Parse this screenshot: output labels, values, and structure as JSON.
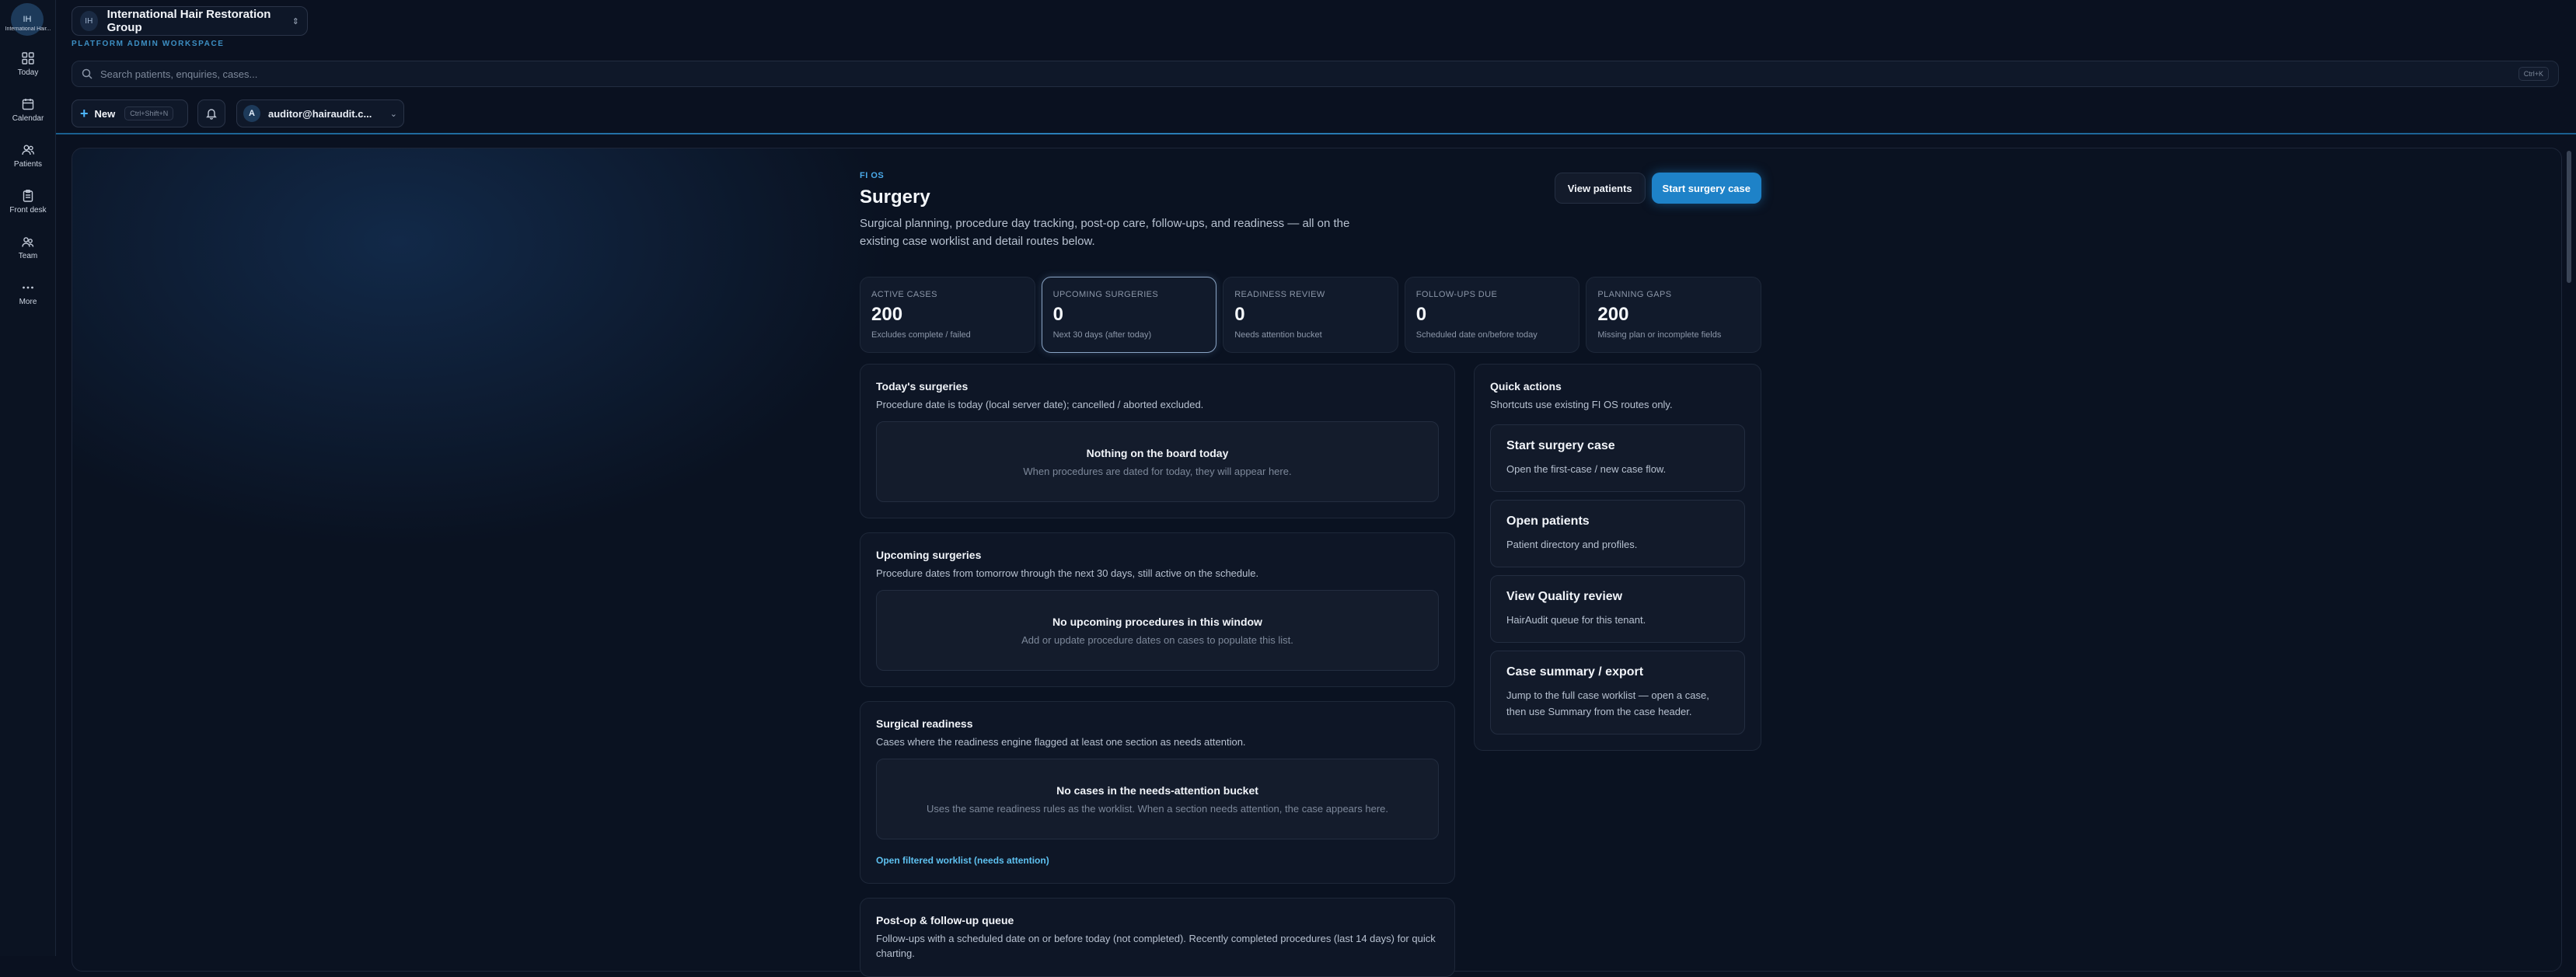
{
  "rail": {
    "logo_initials": "IH",
    "logo_caption": "International Hair...",
    "items": [
      {
        "label": "Today",
        "icon": "grid-icon"
      },
      {
        "label": "Calendar",
        "icon": "calendar-icon"
      },
      {
        "label": "Patients",
        "icon": "users-icon"
      },
      {
        "label": "Front desk",
        "icon": "clipboard-icon"
      },
      {
        "label": "Team",
        "icon": "team-icon"
      },
      {
        "label": "More",
        "icon": "more-icon"
      }
    ]
  },
  "header": {
    "tenant_initials": "IH",
    "tenant_name": "International Hair Restoration Group",
    "workspace_label": "PLATFORM ADMIN WORKSPACE",
    "search_placeholder": "Search patients, enquiries, cases...",
    "search_shortcut": "Ctrl+K",
    "new_label": "New",
    "new_shortcut": "Ctrl+Shift+N",
    "user_initial": "A",
    "user_email": "auditor@hairaudit.c..."
  },
  "page": {
    "kicker": "FI OS",
    "title": "Surgery",
    "description": "Surgical planning, procedure day tracking, post-op care, follow-ups, and readiness — all on the existing case worklist and detail routes below.",
    "view_patients_label": "View patients",
    "start_case_label": "Start surgery case"
  },
  "kpis": [
    {
      "label": "ACTIVE CASES",
      "value": "200",
      "note": "Excludes complete / failed"
    },
    {
      "label": "UPCOMING SURGERIES",
      "value": "0",
      "note": "Next 30 days (after today)"
    },
    {
      "label": "READINESS REVIEW",
      "value": "0",
      "note": "Needs attention bucket"
    },
    {
      "label": "FOLLOW-UPS DUE",
      "value": "0",
      "note": "Scheduled date on/before today"
    },
    {
      "label": "PLANNING GAPS",
      "value": "200",
      "note": "Missing plan or incomplete fields"
    }
  ],
  "sections": {
    "today": {
      "title": "Today's surgeries",
      "desc": "Procedure date is today (local server date); cancelled / aborted excluded.",
      "empty_title": "Nothing on the board today",
      "empty_desc": "When procedures are dated for today, they will appear here."
    },
    "upcoming": {
      "title": "Upcoming surgeries",
      "desc": "Procedure dates from tomorrow through the next 30 days, still active on the schedule.",
      "empty_title": "No upcoming procedures in this window",
      "empty_desc": "Add or update procedure dates on cases to populate this list."
    },
    "readiness": {
      "title": "Surgical readiness",
      "desc": "Cases where the readiness engine flagged at least one section as needs attention.",
      "empty_title": "No cases in the needs-attention bucket",
      "empty_desc": "Uses the same readiness rules as the worklist. When a section needs attention, the case appears here.",
      "link": "Open filtered worklist (needs attention)"
    },
    "postop": {
      "title": "Post-op & follow-up queue",
      "desc": "Follow-ups with a scheduled date on or before today (not completed). Recently completed procedures (last 14 days) for quick charting."
    }
  },
  "quick_actions": {
    "title": "Quick actions",
    "desc": "Shortcuts use existing FI OS routes only.",
    "items": [
      {
        "title": "Start surgery case",
        "desc": "Open the first-case / new case flow."
      },
      {
        "title": "Open patients",
        "desc": "Patient directory and profiles."
      },
      {
        "title": "View Quality review",
        "desc": "HairAudit queue for this tenant."
      },
      {
        "title": "Case summary / export",
        "desc": "Jump to the full case worklist — open a case, then use Summary from the case header."
      }
    ]
  }
}
